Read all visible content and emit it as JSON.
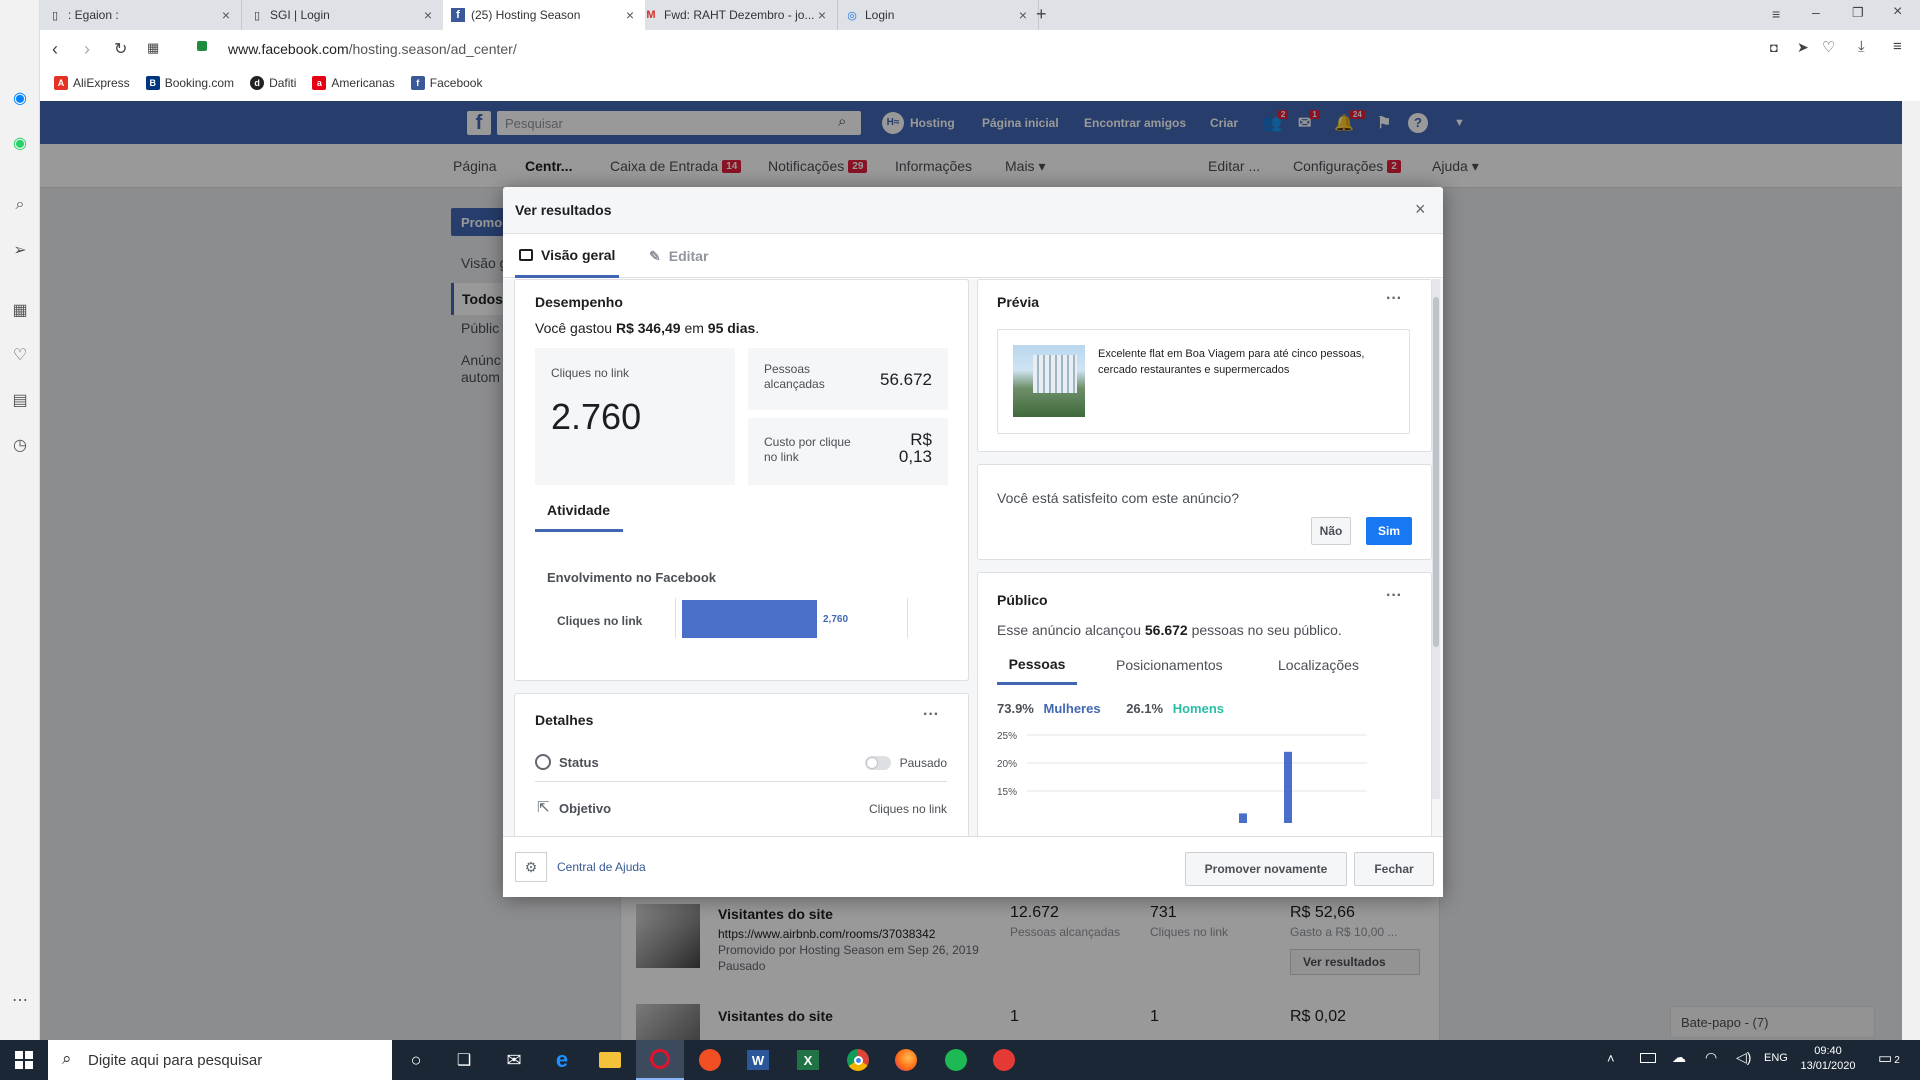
{
  "browser": {
    "tabs": [
      {
        "title": ": Egaion :"
      },
      {
        "title": "SGI | Login"
      },
      {
        "title": "(25) Hosting Season"
      },
      {
        "title": "Fwd: RAHT Dezembro - jo..."
      },
      {
        "title": "Login"
      }
    ],
    "url_host": "www.facebook.com",
    "url_path": "/hosting.season/ad_center/",
    "bookmarks": [
      "AliExpress",
      "Booking.com",
      "Dafiti",
      "Americanas",
      "Facebook"
    ]
  },
  "fb_header": {
    "search_placeholder": "Pesquisar",
    "page_name": "Hosting",
    "home": "Página inicial",
    "find_friends": "Encontrar amigos",
    "create": "Criar",
    "badges": {
      "friends": "2",
      "messages": "1",
      "notifications": "24"
    }
  },
  "page_nav": {
    "items": [
      "Página",
      "Centr...",
      "Caixa de Entrada",
      "Notificações",
      "Informações",
      "Mais ▾"
    ],
    "inbox_badge": "14",
    "notif_badge": "29",
    "edit": "Editar ...",
    "settings": "Configurações",
    "settings_badge": "2",
    "help": "Ajuda ▾"
  },
  "left_panel": {
    "promote": "Promo",
    "items": [
      "Visão g",
      "Todos",
      "Públic",
      "Anúnc",
      "autom"
    ]
  },
  "modal": {
    "title": "Ver resultados",
    "tab_overview": "Visão geral",
    "tab_edit": "Editar",
    "performance": {
      "title": "Desempenho",
      "spent_prefix": "Você gastou",
      "spent_amount": "R$ 346,49",
      "spent_mid": "em",
      "spent_days": "95 dias",
      "clicks_label": "Cliques no link",
      "clicks_value": "2.760",
      "reach_label": "Pessoas alcançadas",
      "reach_value": "56.672",
      "cpc_label": "Custo por clique no link",
      "cpc_value": "R$ 0,13",
      "activity_tab": "Atividade",
      "engagement_title": "Envolvimento no Facebook",
      "bar_label": "Cliques no link",
      "bar_value": "2,760"
    },
    "details": {
      "title": "Detalhes",
      "status_label": "Status",
      "status_value": "Pausado",
      "objective_label": "Objetivo",
      "objective_value": "Cliques no link"
    },
    "preview": {
      "title": "Prévia",
      "ad_text": "Excelente flat em Boa Viagem para até cinco pessoas, cercado restaurantes e supermercados"
    },
    "satisfaction": {
      "question": "Você está satisfeito com este anúncio?",
      "no": "Não",
      "yes": "Sim"
    },
    "audience": {
      "title": "Público",
      "reach_prefix": "Esse anúncio alcançou",
      "reach_value": "56.672",
      "reach_suffix": "pessoas no seu público.",
      "tabs": [
        "Pessoas",
        "Posicionamentos",
        "Localizações"
      ],
      "women_pct": "73.9%",
      "women_label": "Mulheres",
      "men_pct": "26.1%",
      "men_label": "Homens",
      "y_ticks": [
        "25%",
        "20%",
        "15%"
      ]
    },
    "footer": {
      "help_center": "Central de Ajuda",
      "promote_again": "Promover novamente",
      "close": "Fechar"
    }
  },
  "background_list": {
    "rows": [
      {
        "title": "Visitantes do site",
        "url": "https://www.airbnb.com/rooms/37038342",
        "promoted": "Promovido por Hosting Season em Sep 26, 2019",
        "status": "Pausado",
        "reach": "12.672",
        "reach_label": "Pessoas alcançadas",
        "clicks": "731",
        "clicks_label": "Cliques no link",
        "spent": "R$ 52,66",
        "spent_label": "Gasto a R$ 10,00 ...",
        "button": "Ver resultados"
      },
      {
        "title": "Visitantes do site",
        "reach": "1",
        "clicks": "1",
        "spent": "R$ 0,02"
      }
    ]
  },
  "chat": {
    "label": "Bate-papo - (7)"
  },
  "taskbar": {
    "search_placeholder": "Digite aqui para pesquisar",
    "lang": "ENG",
    "time": "09:40",
    "date": "13/01/2020",
    "notif_count": "2"
  },
  "chart_data": [
    {
      "type": "bar",
      "title": "Envolvimento no Facebook",
      "categories": [
        "Cliques no link"
      ],
      "values": [
        2760
      ]
    },
    {
      "type": "bar",
      "y_ticks_shown": [
        "25%",
        "20%",
        "15%"
      ],
      "series": [
        {
          "name": "Mulheres",
          "values": [
            0.3,
            11,
            22,
            8
          ]
        }
      ]
    }
  ],
  "colors": {
    "fb_blue": "#4267b2",
    "accent": "#1877f2",
    "men_green": "#2bbca5",
    "bar_blue": "#4a6fc9"
  }
}
